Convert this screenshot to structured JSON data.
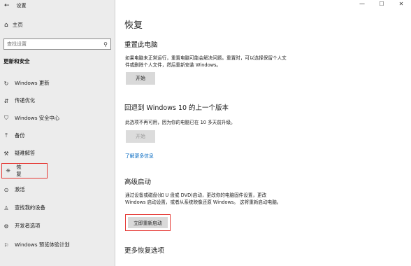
{
  "window": {
    "title": "设置",
    "minimize": "—",
    "maximize": "☐",
    "close": "✕"
  },
  "sidebar": {
    "home": "主页",
    "search_placeholder": "查找设置",
    "group_title": "更新和安全",
    "items": [
      {
        "label": "Windows 更新",
        "icon": "refresh-icon"
      },
      {
        "label": "传递优化",
        "icon": "delivery-icon"
      },
      {
        "label": "Windows 安全中心",
        "icon": "shield-icon"
      },
      {
        "label": "备份",
        "icon": "backup-icon"
      },
      {
        "label": "疑难解答",
        "icon": "wrench-icon"
      },
      {
        "label": "恢复",
        "icon": "recovery-icon"
      },
      {
        "label": "激活",
        "icon": "activation-icon"
      },
      {
        "label": "查找我的设备",
        "icon": "find-device-icon"
      },
      {
        "label": "开发者选项",
        "icon": "developer-icon"
      },
      {
        "label": "Windows 预览体验计划",
        "icon": "insider-icon"
      }
    ],
    "selected_index": 5
  },
  "main": {
    "title": "恢复",
    "reset": {
      "heading": "重置此电脑",
      "text": "如果电脑未正常运行，重置电脑可能会解决问题。重置时，可以选择保留个人文件或删除个人文件，然后重新安装 Windows。",
      "button": "开始"
    },
    "goback": {
      "heading": "回退到 Windows 10 的上一个版本",
      "text": "此选项不再可用，因为你的电脑已在 10 多天前升级。",
      "button": "开始",
      "link": "了解更多信息"
    },
    "advanced": {
      "heading": "高级启动",
      "text": "通过设备或磁盘(如 U 盘或 DVD)启动，更改你的电脑固件设置，更改 Windows 启动设置，或者从系统映像还原 Windows。 这将重新启动电脑。",
      "button": "立即重新启动"
    },
    "more": {
      "heading": "更多恢复选项"
    }
  }
}
